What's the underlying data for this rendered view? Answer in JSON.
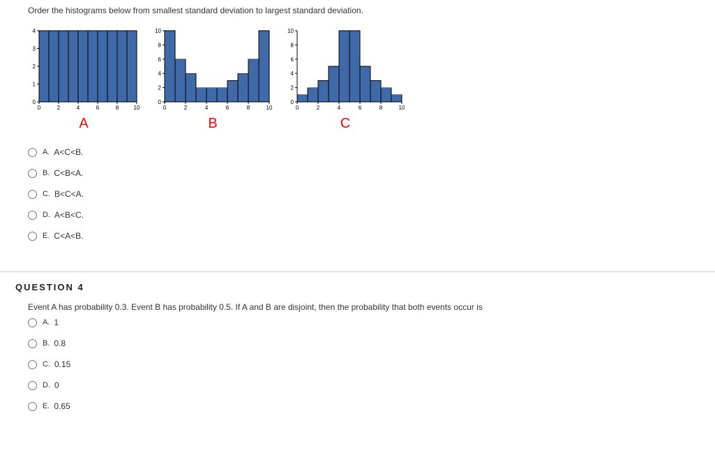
{
  "q3": {
    "prompt": "Order the histograms below from smallest standard deviation to largest standard deviation.",
    "labelA": "A",
    "labelB": "B",
    "labelC": "C",
    "options": {
      "A": {
        "letter": "A.",
        "text": "A<C<B."
      },
      "B": {
        "letter": "B.",
        "text": "C<B<A."
      },
      "C": {
        "letter": "C.",
        "text": "B<C<A."
      },
      "D": {
        "letter": "D.",
        "text": "A<B<C."
      },
      "E": {
        "letter": "E.",
        "text": "C<A<B."
      }
    }
  },
  "q4": {
    "header": "QUESTION 4",
    "prompt": "Event A has probability 0.3. Event B has probability 0.5. If A and B are disjoint, then the probability that both events occur is",
    "options": {
      "A": {
        "letter": "A.",
        "text": "1"
      },
      "B": {
        "letter": "B.",
        "text": "0.8"
      },
      "C": {
        "letter": "C.",
        "text": "0.15"
      },
      "D": {
        "letter": "D.",
        "text": "0"
      },
      "E": {
        "letter": "E.",
        "text": "0.65"
      }
    }
  },
  "chart_data": [
    {
      "type": "bar",
      "name": "A",
      "x": [
        0,
        1,
        2,
        3,
        4,
        5,
        6,
        7,
        8,
        9
      ],
      "values": [
        4,
        4,
        4,
        4,
        4,
        4,
        4,
        4,
        4,
        4
      ],
      "ylim": [
        0,
        4
      ],
      "xlim": [
        0,
        10
      ],
      "xlabel": "",
      "ylabel": ""
    },
    {
      "type": "bar",
      "name": "B",
      "x": [
        0,
        1,
        2,
        3,
        4,
        5,
        6,
        7,
        8,
        9
      ],
      "values": [
        10,
        6,
        4,
        2,
        2,
        2,
        3,
        4,
        6,
        10
      ],
      "ylim": [
        0,
        10
      ],
      "xlim": [
        0,
        10
      ],
      "xlabel": "",
      "ylabel": ""
    },
    {
      "type": "bar",
      "name": "C",
      "x": [
        0,
        1,
        2,
        3,
        4,
        5,
        6,
        7,
        8,
        9
      ],
      "values": [
        1,
        2,
        3,
        5,
        10,
        10,
        5,
        3,
        2,
        1
      ],
      "ylim": [
        0,
        10
      ],
      "xlim": [
        0,
        10
      ],
      "xlabel": "",
      "ylabel": ""
    }
  ]
}
